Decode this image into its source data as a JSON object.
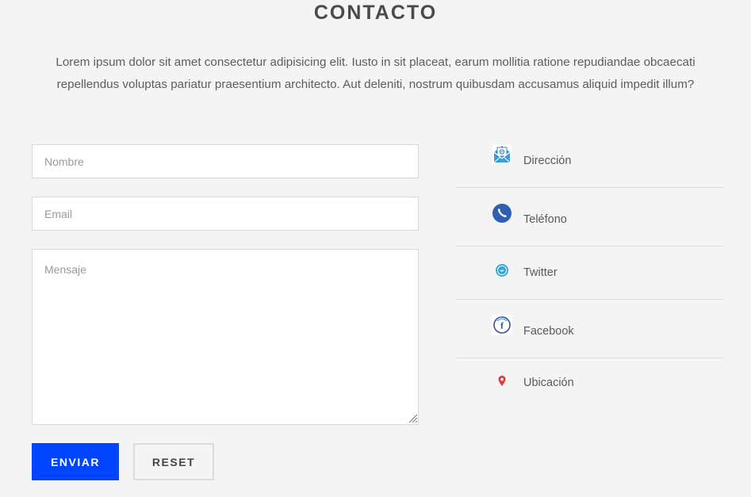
{
  "header": {
    "title": "CONTACTO",
    "intro_line1": "Lorem ipsum dolor sit amet consectetur adipisicing elit. Iusto in sit placeat, earum mollitia ratione repudiandae obcaecati",
    "intro_line2": "repellendus voluptas pariatur praesentium architecto. Aut deleniti, nostrum quibusdam accusamus aliquid impedit illum?"
  },
  "form": {
    "name_placeholder": "Nombre",
    "email_placeholder": "Email",
    "message_placeholder": "Mensaje",
    "send_label": "ENVIAR",
    "reset_label": "RESET"
  },
  "contact_info": {
    "items": [
      {
        "label": "Dirección",
        "icon": "envelope-icon"
      },
      {
        "label": "Teléfono",
        "icon": "phone-icon"
      },
      {
        "label": "Twitter",
        "icon": "twitter-icon"
      },
      {
        "label": "Facebook",
        "icon": "facebook-icon"
      },
      {
        "label": "Ubicación",
        "icon": "location-pin-icon"
      }
    ]
  },
  "colors": {
    "background": "#f4f4f4",
    "primary_button": "#0044ff",
    "text": "#555555"
  }
}
